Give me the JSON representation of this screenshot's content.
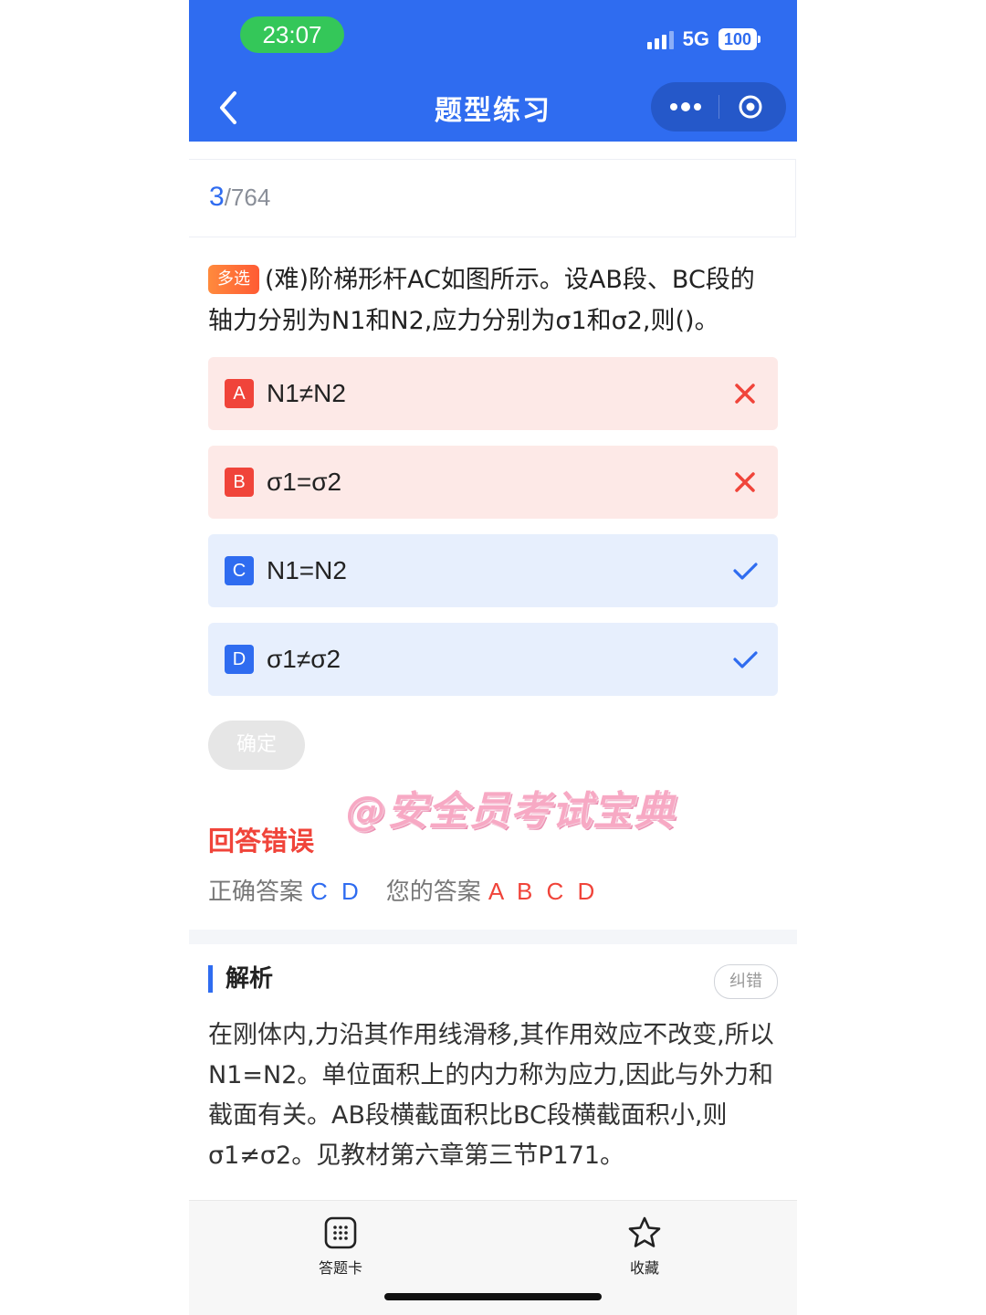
{
  "status_bar": {
    "time": "23:07",
    "network": "5G",
    "battery": "100"
  },
  "nav": {
    "title": "题型练习"
  },
  "progress": {
    "current": "3",
    "total": "/764"
  },
  "question": {
    "tag": "多选",
    "text": "(难)阶梯形杆AC如图所示。设AB段、BC段的轴力分别为N1和N2,应力分别为σ1和σ2,则()。"
  },
  "options": [
    {
      "letter": "A",
      "text": "N1≠N2",
      "status": "wrong"
    },
    {
      "letter": "B",
      "text": "σ1=σ2",
      "status": "wrong"
    },
    {
      "letter": "C",
      "text": "N1=N2",
      "status": "correct"
    },
    {
      "letter": "D",
      "text": "σ1≠σ2",
      "status": "correct"
    }
  ],
  "confirm_label": "确定",
  "watermark": "@安全员考试宝典",
  "result": {
    "title": "回答错误",
    "correct_label": "正确答案",
    "correct_value": "C D",
    "yours_label": "您的答案",
    "yours_value": "A B C D"
  },
  "analysis": {
    "title": "解析",
    "report_label": "纠错",
    "text": "在刚体内,力沿其作用线滑移,其作用效应不改变,所以N1=N2。单位面积上的内力称为应力,因此与外力和截面有关。AB段横截面积比BC段横截面积小,则σ1≠σ2。见教材第六章第三节P171。"
  },
  "bottom_tabs": {
    "card": "答题卡",
    "favorite": "收藏"
  },
  "colors": {
    "primary": "#2f6cf0",
    "error": "#f0443a",
    "wrong_bg": "#fde9e7",
    "right_bg": "#e7effd"
  },
  "icons": [
    "back-arrow-icon",
    "more-dots-icon",
    "target-icon",
    "close-icon",
    "check-icon",
    "answer-card-icon",
    "star-icon"
  ]
}
